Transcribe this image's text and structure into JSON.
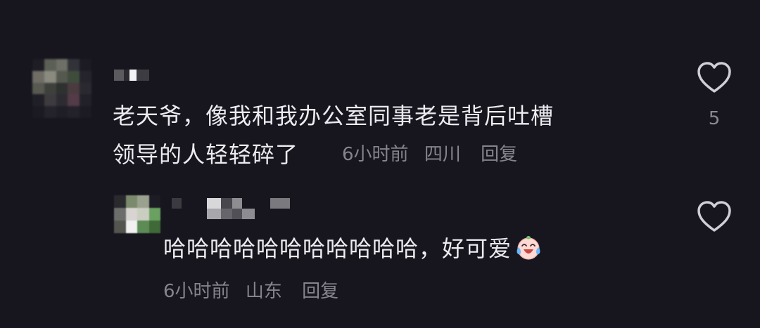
{
  "comment": {
    "text_line1": "老天爷，像我和我办公室同事老是背后吐槽",
    "text_line2": "领导的人轻轻碎了",
    "time": "6小时前",
    "location": "四川",
    "reply_label": "回复",
    "like_count": "5",
    "like_icon": "heart-outline-icon"
  },
  "reply": {
    "text": "哈哈哈哈哈哈哈哈哈哈哈，好可爱",
    "emoji": "crying-laughing-emoji-icon",
    "time": "6小时前",
    "location": "山东",
    "reply_label": "回复",
    "like_icon": "heart-outline-icon"
  },
  "colors": {
    "background": "#17161f",
    "text": "#ecebf0",
    "meta": "#85848c"
  }
}
